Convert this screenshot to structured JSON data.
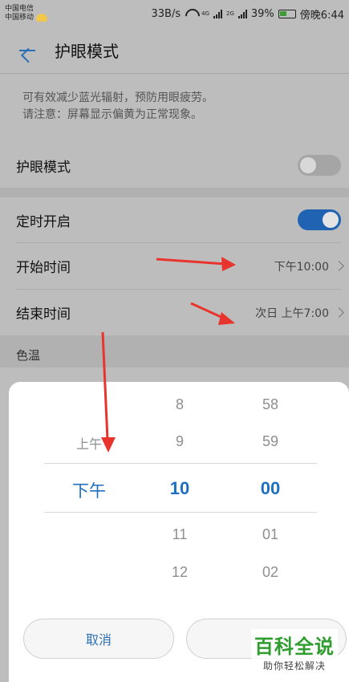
{
  "status_bar": {
    "carrier1": "中国电信",
    "carrier2": "中国移动",
    "speed": "33B/s",
    "net1": "4G",
    "net2": "2G",
    "battery": "39%",
    "time": "傍晚6:44"
  },
  "header": {
    "title": "护眼模式"
  },
  "description": {
    "line1": "可有效减少蓝光辐射，预防用眼疲劳。",
    "line2": "请注意：屏幕显示偏黄为正常现象。"
  },
  "rows": {
    "eye_mode": {
      "label": "护眼模式",
      "toggle": "off"
    },
    "schedule": {
      "label": "定时开启",
      "toggle": "on"
    },
    "start_time": {
      "label": "开始时间",
      "value": "下午10:00"
    },
    "end_time": {
      "label": "结束时间",
      "value": "次日 上午7:00"
    }
  },
  "section_label": "色温",
  "picker": {
    "period": {
      "above": "上午",
      "selected": "下午"
    },
    "hour": {
      "above2": "8",
      "above1": "9",
      "selected": "10",
      "below1": "11",
      "below2": "12"
    },
    "minute": {
      "above2": "58",
      "above1": "59",
      "selected": "00",
      "below1": "01",
      "below2": "02"
    },
    "cancel_label": "取消"
  },
  "watermark": {
    "main": "百科全说",
    "sub": "助你轻松解决"
  },
  "colors": {
    "accent": "#2063b3",
    "arrow": "#e8342d",
    "watermark": "#2e9d2e"
  }
}
